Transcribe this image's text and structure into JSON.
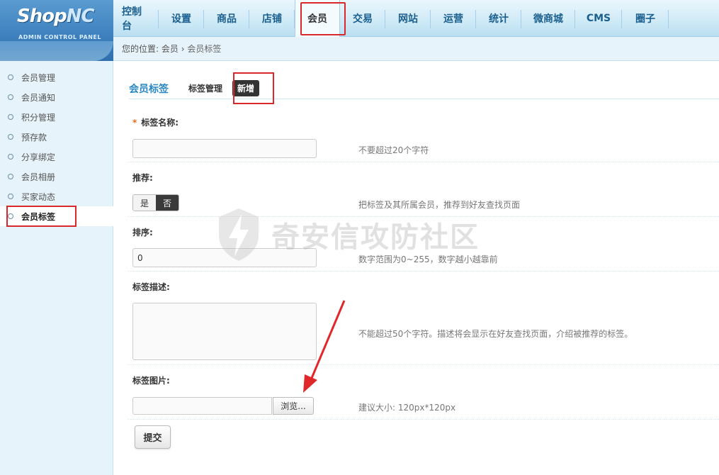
{
  "logo": {
    "main": "Shop",
    "accent": "NC",
    "subtitle": "ADMIN CONTROL PANEL"
  },
  "nav": [
    {
      "label": "控制台"
    },
    {
      "label": "设置"
    },
    {
      "label": "商品"
    },
    {
      "label": "店铺"
    },
    {
      "label": "会员"
    },
    {
      "label": "交易"
    },
    {
      "label": "网站"
    },
    {
      "label": "运营"
    },
    {
      "label": "统计"
    },
    {
      "label": "微商城"
    },
    {
      "label": "CMS"
    },
    {
      "label": "圈子"
    }
  ],
  "breadcrumb": {
    "prefix": "您的位置:",
    "section": "会员",
    "sep": "›",
    "current": "会员标签"
  },
  "sidebar": [
    {
      "label": "会员管理"
    },
    {
      "label": "会员通知"
    },
    {
      "label": "积分管理"
    },
    {
      "label": "预存款"
    },
    {
      "label": "分享绑定"
    },
    {
      "label": "会员相册"
    },
    {
      "label": "买家动态"
    },
    {
      "label": "会员标签"
    }
  ],
  "tabs": {
    "title": "会员标签",
    "manage": "标签管理",
    "new": "新增"
  },
  "form": {
    "name_label": "标签名称:",
    "required_mark": "*",
    "name_value": "",
    "name_hint": "不要超过20个字符",
    "recommend_label": "推荐:",
    "yes": "是",
    "no": "否",
    "recommend_hint": "把标签及其所属会员，推荐到好友查找页面",
    "sort_label": "排序:",
    "sort_value": "0",
    "sort_hint": "数字范围为0~255，数字越小越靠前",
    "desc_label": "标签描述:",
    "desc_hint": "不能超过50个字符。描述将会显示在好友查找页面，介绍被推荐的标签。",
    "image_label": "标签图片:",
    "browse": "浏览...",
    "image_hint": "建议大小: 120px*120px",
    "submit": "提交"
  },
  "watermark": "奇安信攻防社区",
  "colors": {
    "accent_blue": "#2a87c2",
    "highlight_red": "#d8282b",
    "sidebar_bg": "#e6f3fa"
  }
}
